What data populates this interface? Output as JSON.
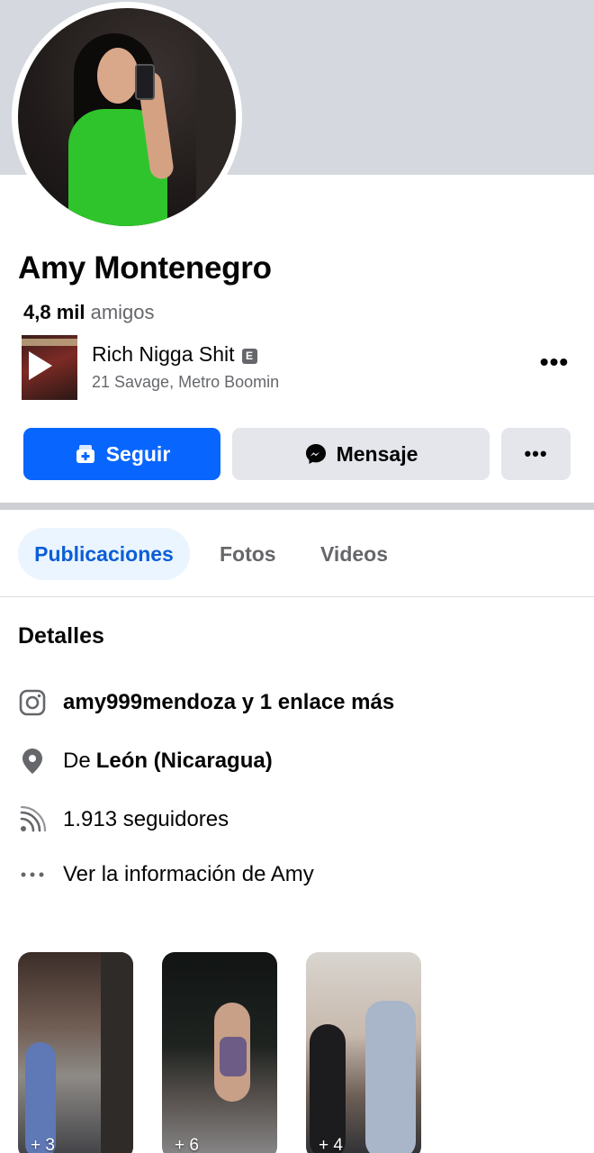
{
  "profile": {
    "name": "Amy Montenegro",
    "friends_count": "4,8 mil",
    "friends_label": "amigos"
  },
  "song": {
    "title": "Rich Nigga Shit",
    "explicit_badge": "E",
    "artists": "21 Savage, Metro Boomin",
    "more_label": "•••"
  },
  "actions": {
    "follow_label": "Seguir",
    "message_label": "Mensaje",
    "more_label": "•••"
  },
  "tabs": [
    {
      "label": "Publicaciones",
      "active": true
    },
    {
      "label": "Fotos",
      "active": false
    },
    {
      "label": "Videos",
      "active": false
    }
  ],
  "details": {
    "title": "Detalles",
    "instagram": "amy999mendoza y 1 enlace más",
    "location_prefix": "De",
    "location": "León (Nicaragua)",
    "followers": "1.913 seguidores",
    "more_info": "Ver la información de Amy"
  },
  "photos": [
    {
      "count": "+ 3"
    },
    {
      "count": "+ 6"
    },
    {
      "count": "+ 4"
    }
  ],
  "colors": {
    "accent": "#0866ff",
    "tab_active_bg": "#ebf5ff",
    "secondary_button": "#e4e6eb",
    "muted_text": "#65676b"
  }
}
